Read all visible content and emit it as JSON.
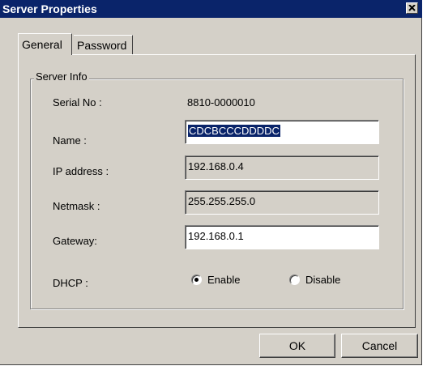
{
  "window": {
    "title": "Server Properties",
    "close_label": "✕"
  },
  "tabs": [
    {
      "label": "General",
      "active": true
    },
    {
      "label": "Password",
      "active": false
    }
  ],
  "server_info": {
    "group_label": "Server Info",
    "serial": {
      "label": "Serial No :",
      "value": "8810-0000010"
    },
    "name": {
      "label": "Name :",
      "value": "CDCBCCCDDDDC"
    },
    "ip": {
      "label": "IP address :",
      "value": "192.168.0.4"
    },
    "netmask": {
      "label": "Netmask :",
      "value": "255.255.255.0"
    },
    "gateway": {
      "label": "Gateway:",
      "value": "192.168.0.1"
    },
    "dhcp": {
      "label": "DHCP :",
      "options": [
        "Enable",
        "Disable"
      ],
      "selected": "Enable"
    }
  },
  "buttons": {
    "ok": "OK",
    "cancel": "Cancel"
  },
  "colors": {
    "title_bar": "#0a246a",
    "face": "#d4d0c8",
    "selection": "#0a246a"
  },
  "icons": {
    "close": "close-icon"
  }
}
